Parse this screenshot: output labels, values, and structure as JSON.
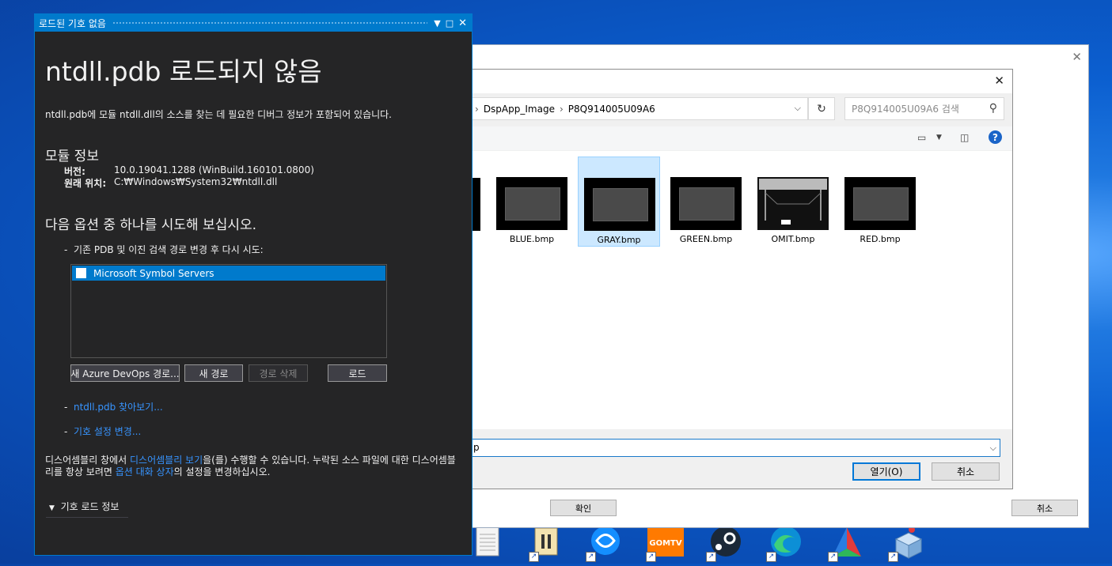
{
  "vs_panel": {
    "tab_title": "로드된 기호 없음",
    "heading": "ntdll.pdb 로드되지 않음",
    "description": "ntdll.pdb에 모듈 ntdll.dll의 소스를 찾는 데 필요한 디버그 정보가 포함되어 있습니다.",
    "module_info_heading": "모듈 정보",
    "version_label": "버전:",
    "version_value": "10.0.19041.1288 (WinBuild.160101.0800)",
    "location_label": "원래 위치:",
    "location_value": "C:₩Windows₩System32₩ntdll.dll",
    "options_heading": "다음 옵션 중 하나를 시도해 보십시오.",
    "option1_text": "기존 PDB 및 이진 검색 경로 변경 후 다시 시도:",
    "symbol_servers": [
      "Microsoft Symbol Servers"
    ],
    "btn_new_azure": "새 Azure DevOps 경로...",
    "btn_new_path": "새 경로",
    "btn_delete_path": "경로 삭제",
    "btn_load": "로드",
    "link_browse": "ntdll.pdb 찾아보기...",
    "link_symbol_settings": "기호 설정 변경...",
    "para_part1": "디스어셈블리 창에서 ",
    "para_link1": "디스어셈블리 보기",
    "para_part2": "을(를) 수행할 수 있습니다. 누락된 소스 파일에 대한 디스어셈블리를 항상 보려면 ",
    "para_link2": "옵션 대화 상자",
    "para_part3": "의 설정을 변경하십시오.",
    "expander_label": "기호 로드 정보"
  },
  "file_dialog": {
    "breadcrumb": [
      "DspApp_Image",
      "P8Q914005U09A6"
    ],
    "search_placeholder": "P8Q914005U09A6 검색",
    "files": [
      {
        "name": "BLUE.bmp",
        "selected": false
      },
      {
        "name": "GRAY.bmp",
        "selected": true
      },
      {
        "name": "GREEN.bmp",
        "selected": false
      },
      {
        "name": "OMIT.bmp",
        "selected": false
      },
      {
        "name": "RED.bmp",
        "selected": false
      }
    ],
    "filename_value": "p",
    "open_label": "열기(O)",
    "cancel_label": "취소"
  },
  "back_dialog": {
    "ok_label": "확인",
    "cancel_label": "취소"
  },
  "colors": {
    "vs_accent": "#007acc",
    "vs_bg": "#252526",
    "link": "#3794ff",
    "selection": "#cce8ff"
  }
}
